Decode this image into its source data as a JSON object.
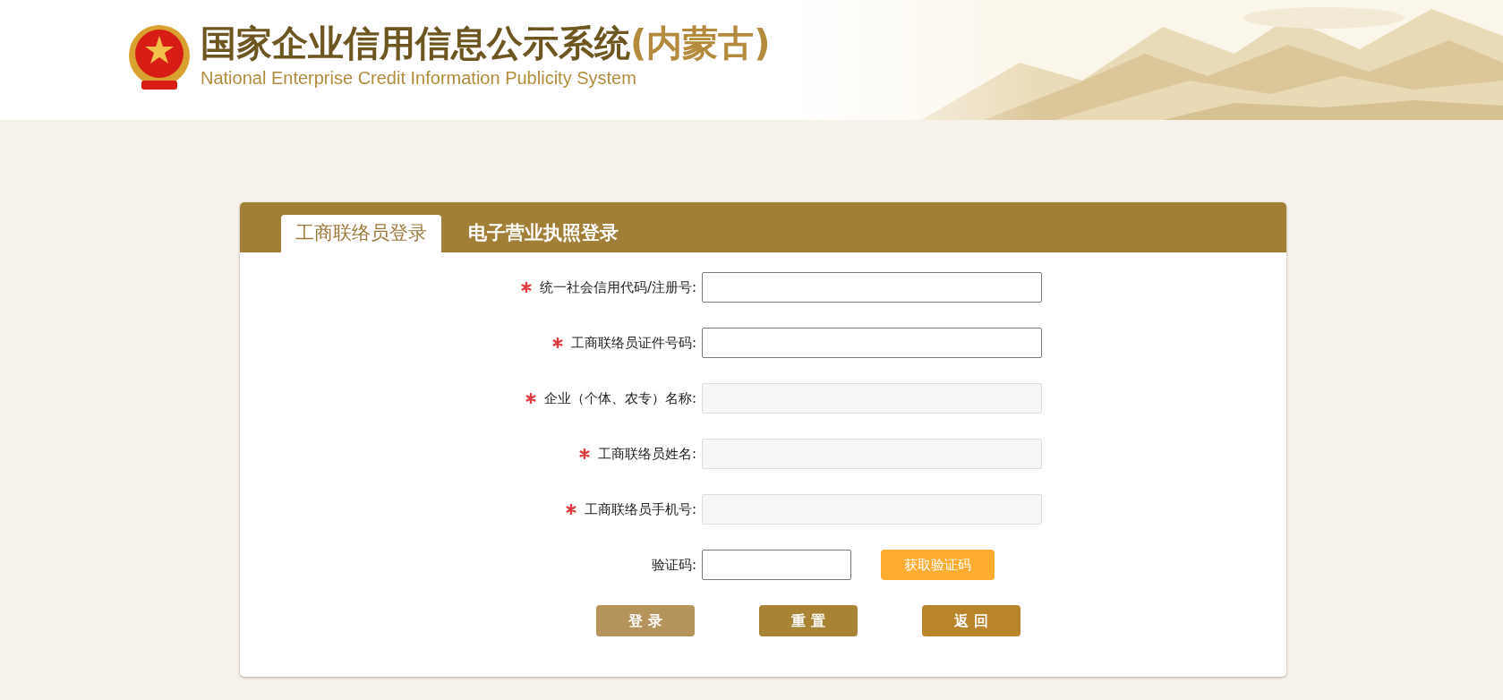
{
  "header": {
    "title": "国家企业信用信息公示系统",
    "region": "(内蒙古)",
    "subtitle": "National Enterprise Credit Information Publicity System"
  },
  "tabs": [
    {
      "label": "工商联络员登录",
      "selected": true
    },
    {
      "label": "电子营业执照登录",
      "selected": false
    }
  ],
  "fields": [
    {
      "kind": "text",
      "label": "统一社会信用代码/注册号:",
      "required": true,
      "disabled": false
    },
    {
      "kind": "text",
      "label": "工商联络员证件号码:",
      "required": true,
      "disabled": false
    },
    {
      "kind": "text",
      "label": "企业（个体、农专）名称:",
      "required": true,
      "disabled": true
    },
    {
      "kind": "text",
      "label": "工商联络员姓名:",
      "required": true,
      "disabled": true
    },
    {
      "kind": "text",
      "label": "工商联络员手机号:",
      "required": true,
      "disabled": true
    },
    {
      "kind": "captcha",
      "label": "验证码:",
      "required": false,
      "disabled": false,
      "button": "获取验证码"
    }
  ],
  "buttons": [
    {
      "label": "登 录",
      "color": "#b4945a"
    },
    {
      "label": "重 置",
      "color": "#a88334"
    },
    {
      "label": "返 回",
      "color": "#b8852a"
    }
  ]
}
